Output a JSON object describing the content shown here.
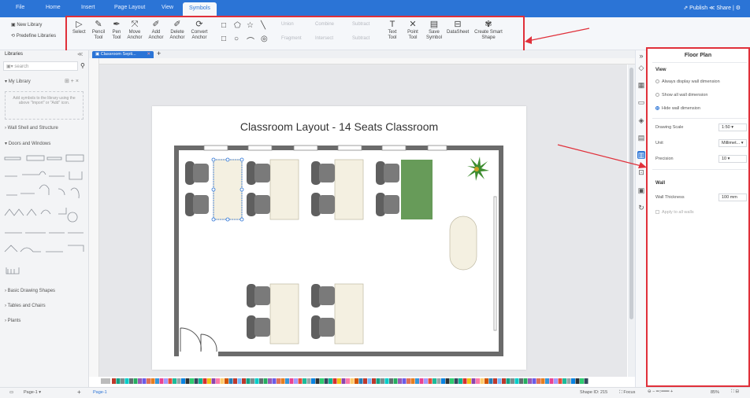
{
  "menubar": {
    "tabs": [
      "File",
      "Home",
      "Insert",
      "Page Layout",
      "View",
      "Symbols"
    ],
    "right": "⇗ Publish  ≪ Share  |  ⚙"
  },
  "ribbon": {
    "library_buttons": {
      "new": "New Library",
      "predefine": "Predefine Libraries"
    },
    "select": "Select",
    "tools": [
      {
        "icon": "▷",
        "label": "Select"
      },
      {
        "icon": "✎",
        "label": "Pencil Tool"
      },
      {
        "icon": "✒",
        "label": "Pen Tool"
      },
      {
        "icon": "⤧",
        "label": "Move Anchor"
      },
      {
        "icon": "✐",
        "label": "Add Anchor"
      },
      {
        "icon": "✐",
        "label": "Delete Anchor"
      },
      {
        "icon": "⟳",
        "label": "Convert Anchor"
      }
    ],
    "shapes_row1": [
      "□",
      "⬠",
      "☆",
      "╲"
    ],
    "shapes_row2": [
      "□",
      "○",
      "⌒",
      "◎"
    ],
    "bool_ops": [
      [
        "Union",
        "Combine",
        "Subtract"
      ],
      [
        "Fragment",
        "Intersect",
        "Subtract"
      ]
    ],
    "text_tools": [
      {
        "icon": "T",
        "label": "Text Tool"
      },
      {
        "icon": "✕",
        "label": "Point Tool"
      },
      {
        "icon": "💾",
        "label": "Save Symbol"
      },
      {
        "icon": "⊟",
        "label": "DataSheet"
      },
      {
        "icon": "✾",
        "label": "Create Smart Shape"
      }
    ]
  },
  "libraries": {
    "header": "Libraries",
    "search_placeholder": "search",
    "my_library": "My Library",
    "empty_hint": "Add symbols to the library using the above \"Import\" or \"Add\" icon.",
    "categories": [
      "Wall Shell and Structure",
      "Doors and Windows",
      "Basic Drawing Shapes",
      "Tables and Chairs",
      "Plants"
    ]
  },
  "doc_tab": "Classroom Septi...",
  "canvas": {
    "title": "Classroom Layout - 14 Seats Classroom"
  },
  "panel": {
    "title": "Floor Plan",
    "view_heading": "View",
    "options": [
      {
        "label": "Always display wall dimension",
        "checked": false
      },
      {
        "label": "Show all wall dimension",
        "checked": false
      },
      {
        "label": "Hide wall dimension",
        "checked": true
      }
    ],
    "drawing_scale_label": "Drawing Scale",
    "drawing_scale_value": "1:50",
    "unit_label": "Unit",
    "unit_value": "Millimet...",
    "precision_label": "Precision",
    "precision_value": "10",
    "wall_heading": "Wall",
    "wall_thickness_label": "Wall Thickness",
    "wall_thickness_value": "100 mm",
    "apply_all_label": "Apply to all walls"
  },
  "status": {
    "page_selector": "Page-1",
    "page_tab": "Page-1",
    "shape_id": "Shape ID: 215",
    "focus": "Focus",
    "zoom": "85%"
  },
  "colors": {
    "accent": "#2b74d6",
    "highlight": "#e0303a",
    "wall": "#6b6b6b",
    "desk": "#f4f0e1",
    "chair": "#6a6a6a",
    "green_desk": "#4c8a3c"
  }
}
